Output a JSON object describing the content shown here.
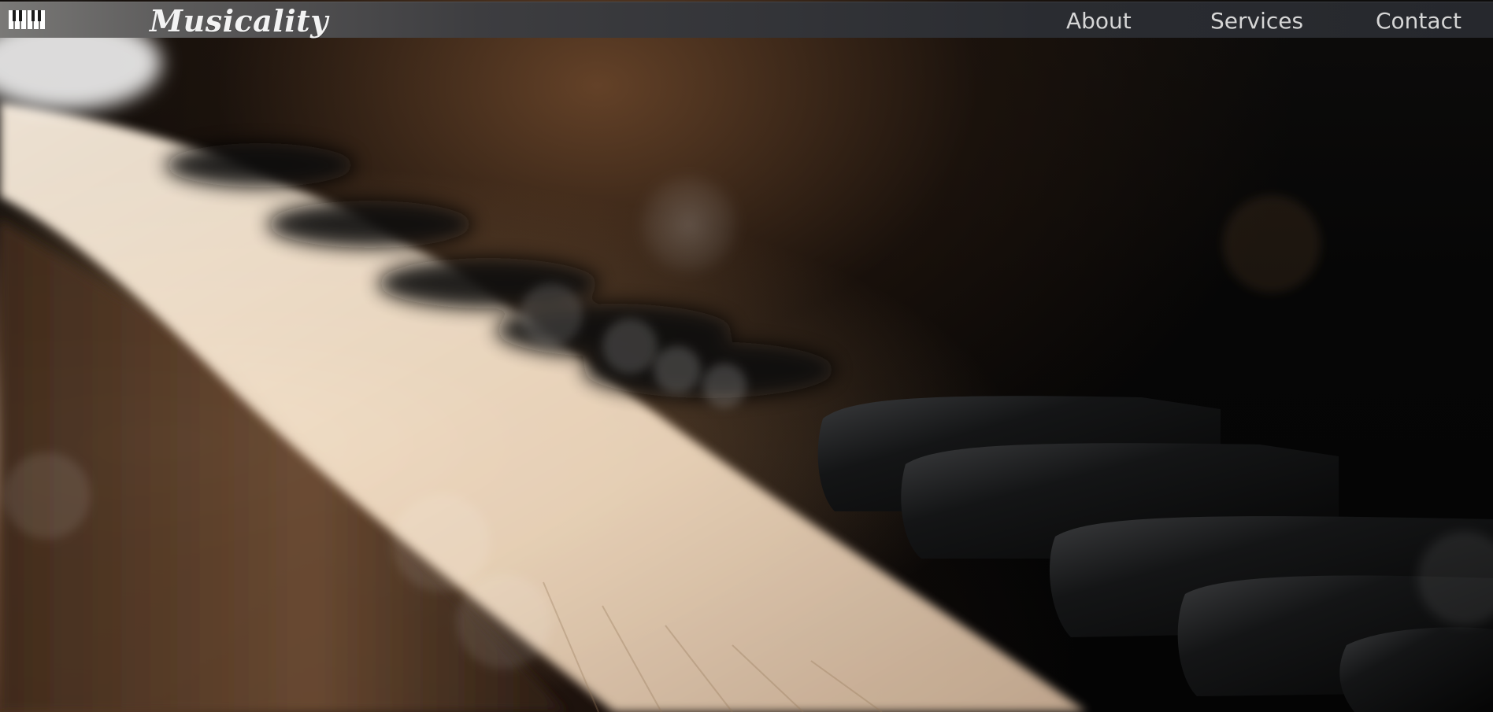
{
  "nav": {
    "brand": "Musicality",
    "logo_icon": "piano-keys-icon",
    "links": [
      {
        "label": "About"
      },
      {
        "label": "Services"
      },
      {
        "label": "Contact"
      }
    ]
  },
  "hero": {
    "background": "piano-keys-photo"
  },
  "colors": {
    "navbar_start": "#7a7977",
    "navbar_end": "#26282d",
    "nav_text": "#d6d6d6",
    "brand_text": "#f3f3f3"
  }
}
